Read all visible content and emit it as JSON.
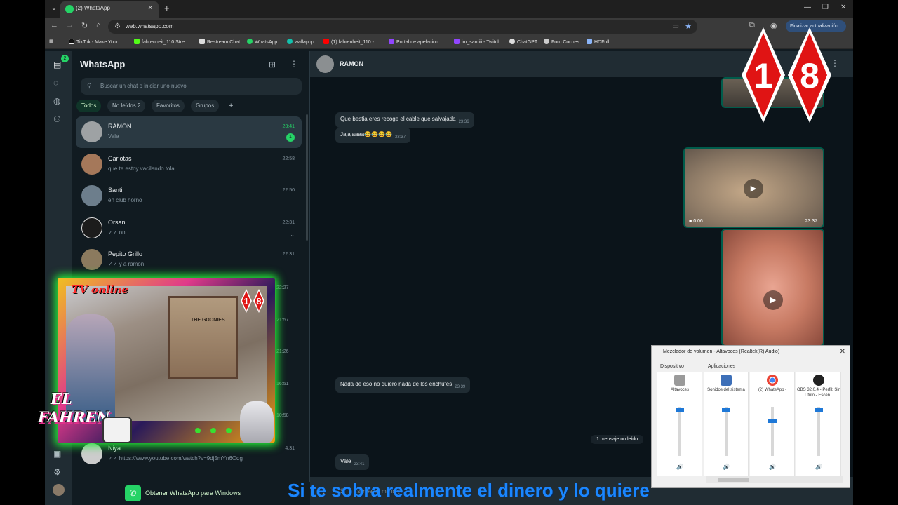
{
  "browser": {
    "tab_title": "(2) WhatsApp",
    "url": "web.whatsapp.com",
    "update_button": "Finalizar actualización",
    "bookmarks": [
      "TikTok - Make Your...",
      "fahrenheit_110 Stre...",
      "Restream Chat",
      "WhatsApp",
      "wallapop",
      "(1) fahrenheit_110 -...",
      "Portal de apelacion...",
      "im_santiii - Twitch",
      "ChatGPT",
      "Foro Coches",
      "HDFull"
    ]
  },
  "rail": {
    "badge": "2"
  },
  "sidebar": {
    "title": "WhatsApp",
    "search_placeholder": "Buscar un chat o iniciar uno nuevo",
    "filters": [
      "Todos",
      "No leídos 2",
      "Favoritos",
      "Grupos",
      "+"
    ],
    "chats": [
      {
        "name": "RAMON",
        "preview": "Vale",
        "time": "23:41",
        "unread": "1"
      },
      {
        "name": "Carlotas",
        "preview": "que te estoy vacilando tolai",
        "time": "22:58"
      },
      {
        "name": "Santi",
        "preview": "en club horno",
        "time": "22:50"
      },
      {
        "name": "Orsan",
        "preview": "✓✓ on",
        "time": "22:31"
      },
      {
        "name": "Pepito Grillo",
        "preview": "✓✓ y a ramon",
        "time": "22:31"
      }
    ],
    "hidden_times": [
      "22:27",
      "21:57",
      "21:26",
      "16:51",
      "10:58",
      "4:31"
    ],
    "partial_chat": {
      "name": "Niya",
      "preview": "✓✓ https://www.youtube.com/watch?v=9dj5mYn6Oqg"
    },
    "get_app": "Obtener WhatsApp para Windows"
  },
  "conversation": {
    "contact": "RAMON",
    "messages": [
      {
        "text": "Que bestia eres recoge el cable que salvajada",
        "time": "23:36"
      },
      {
        "text": "Jajajaaaa😂😂😂😂",
        "time": "23:37"
      },
      {
        "text": "Nada de eso no quiero nada de los enchufes",
        "time": "23:39"
      },
      {
        "text": "Vale",
        "time": "23:41"
      }
    ],
    "video": {
      "duration": "0:06",
      "time": "23:37"
    },
    "unread_divider": "1 mensaje no leído",
    "composer_placeholder": "Escribe un mensaje"
  },
  "overlay": {
    "logo_digits": [
      "1",
      "8"
    ],
    "cam_label": "TV online",
    "cam_logo": [
      "1",
      "8"
    ],
    "poster_text": "THE GOONIES",
    "brand_line1": "EL",
    "brand_line2": "FAHREN",
    "subtitle": "Si te sobra realmente el dinero y lo quiere"
  },
  "mixer": {
    "title": "Mezclador de volumen - Altavoces (Realtek(R) Audio)",
    "device_label": "Dispositivo",
    "apps_label": "Aplicaciones",
    "channels": [
      {
        "name": "Altavoces",
        "level": 0.95
      },
      {
        "name": "Sonidos del sistema",
        "level": 0.95
      },
      {
        "name": "(2) WhatsApp -",
        "level": 0.72
      },
      {
        "name": "OBS 32.0.4 - Perfil: Sin Título - Escen...",
        "level": 0.95
      }
    ]
  },
  "colors": {
    "accent": "#25d366",
    "panel": "#111b21",
    "header": "#202c33",
    "subtitle": "#1a86ff"
  }
}
